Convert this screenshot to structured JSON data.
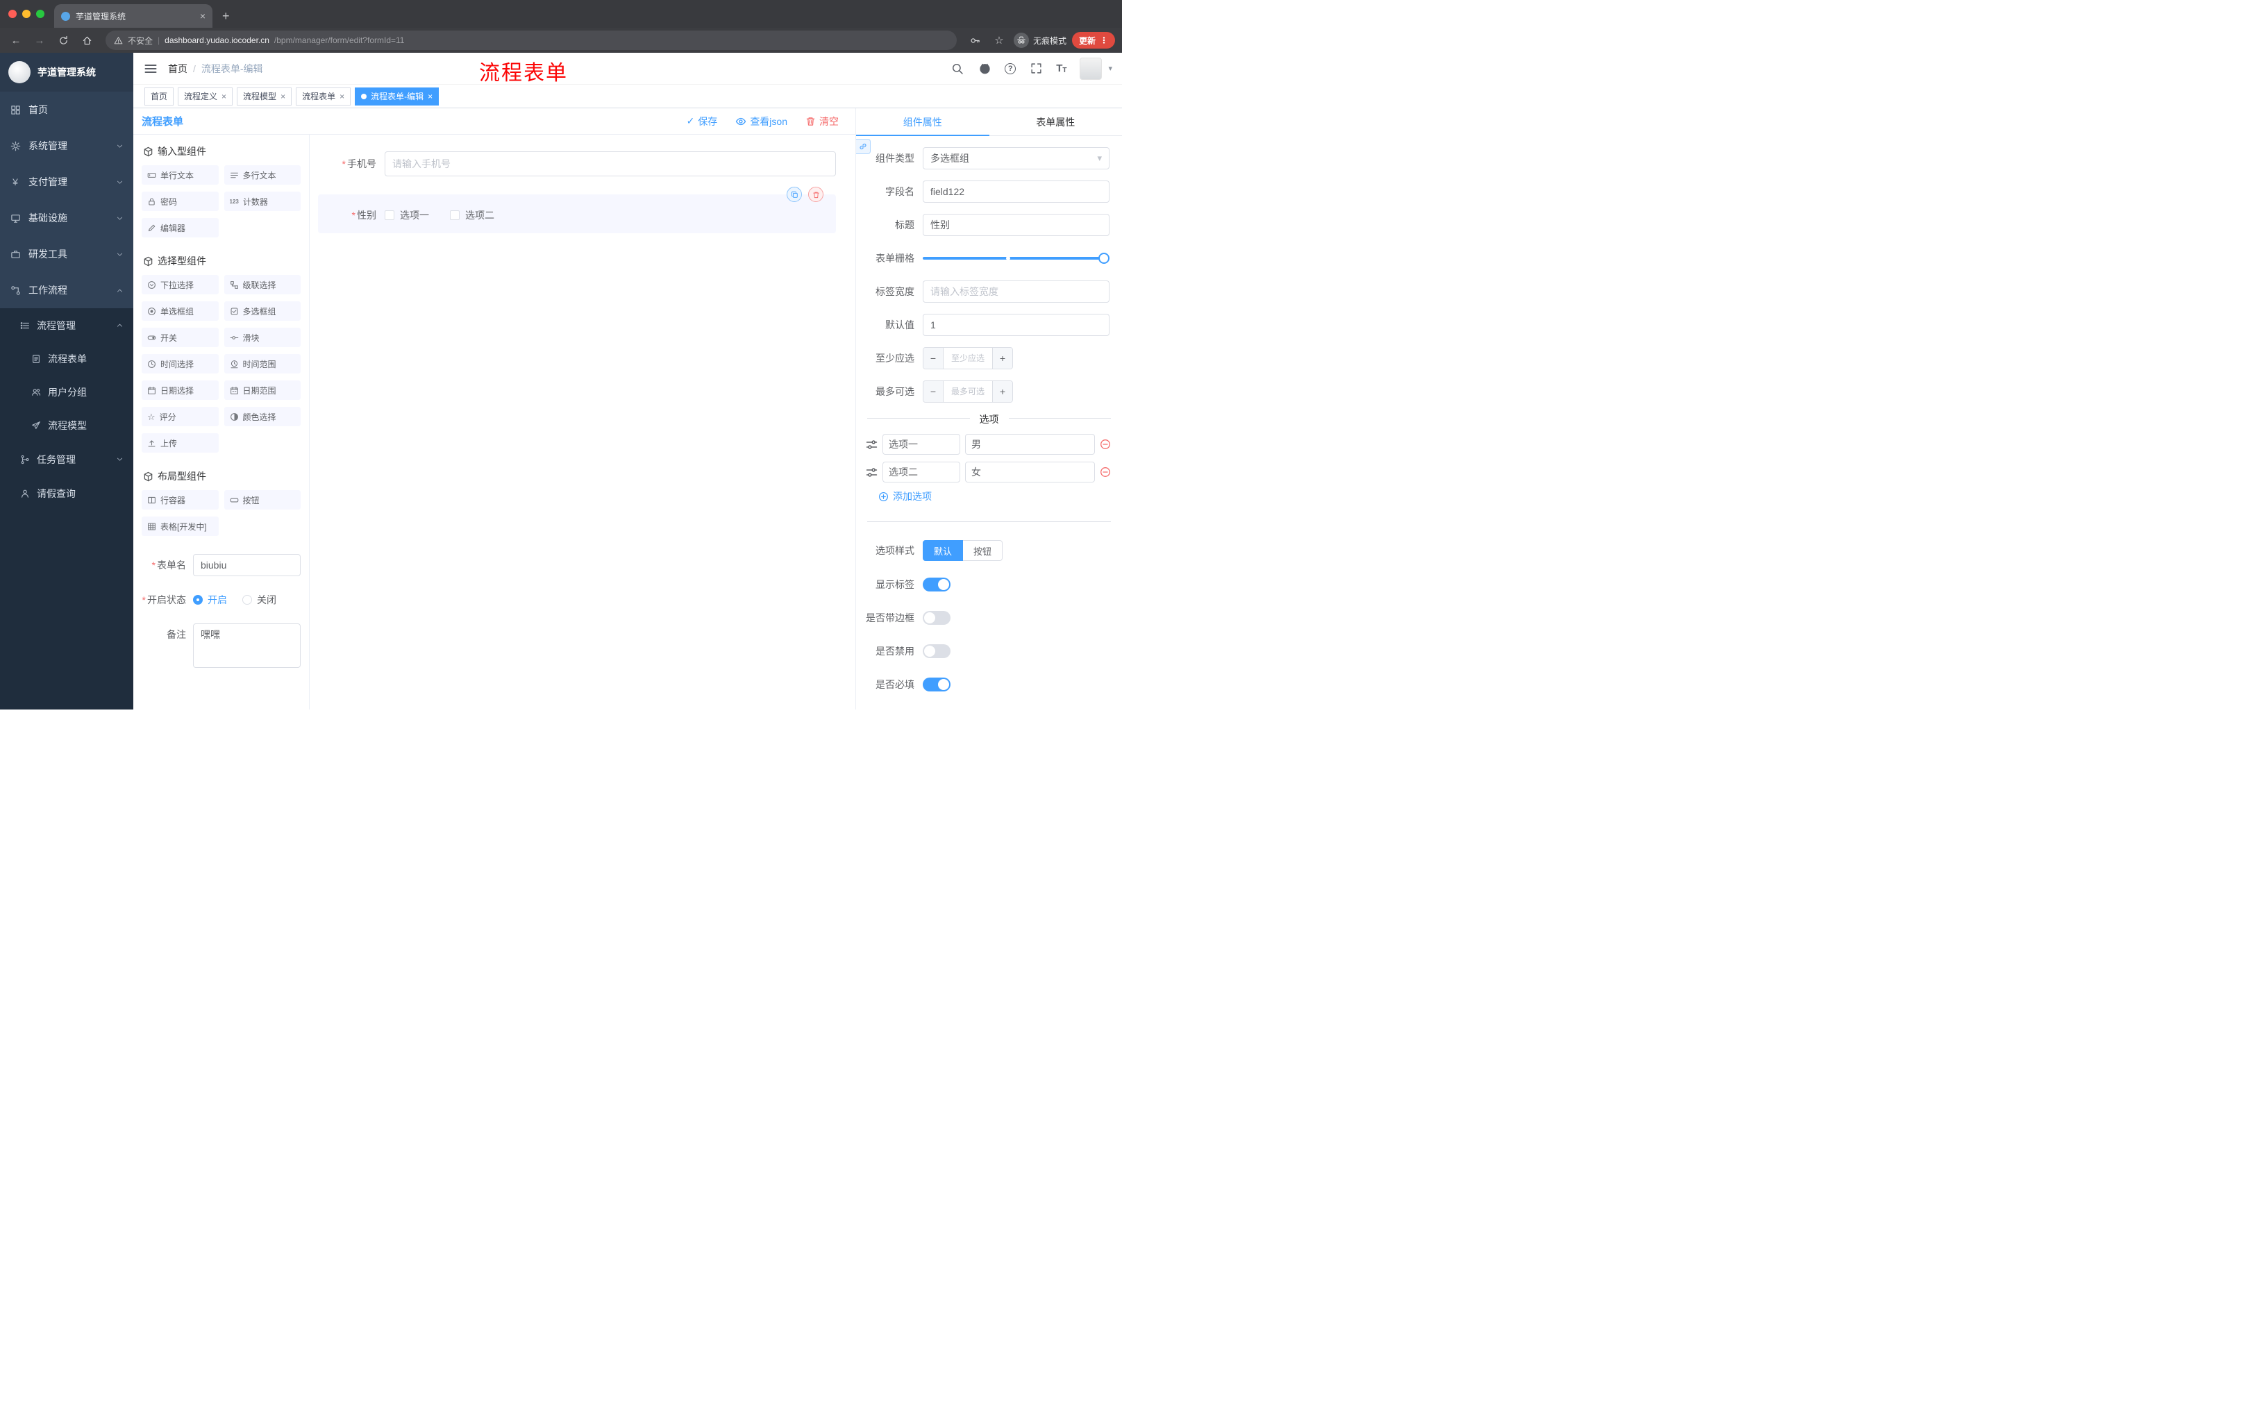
{
  "icons": {
    "close": "×",
    "new_tab": "+",
    "back": "←",
    "forward": "→",
    "more": "⋮",
    "star": "☆",
    "check": "✓",
    "caret_down": "▾",
    "minus": "−",
    "plus": "+",
    "yen": "¥",
    "help": "?",
    "asterisk": "*",
    "counter": "123",
    "slash": "/",
    "pipe": "|",
    "font_big": "T",
    "font_small": "T"
  },
  "browser": {
    "tab": {
      "title": "芋道管理系统"
    },
    "address": {
      "security": "不安全",
      "domain": "dashboard.yudao.iocoder.cn",
      "path": "/bpm/manager/form/edit?formId=11"
    },
    "incognito": "无痕模式",
    "update": "更新"
  },
  "sidebar": {
    "app_title": "芋道管理系统",
    "items": [
      {
        "label": "首页"
      },
      {
        "label": "系统管理"
      },
      {
        "label": "支付管理"
      },
      {
        "label": "基础设施"
      },
      {
        "label": "研发工具"
      },
      {
        "label": "工作流程"
      }
    ],
    "submenu": {
      "process_mgmt": {
        "label": "流程管理",
        "children": [
          {
            "label": "流程表单"
          },
          {
            "label": "用户分组"
          },
          {
            "label": "流程模型"
          }
        ]
      },
      "task_mgmt": {
        "label": "任务管理"
      },
      "leave_query": {
        "label": "请假查询"
      }
    }
  },
  "header": {
    "breadcrumb": {
      "root": "首页",
      "current": "流程表单-编辑"
    },
    "annotation": "流程表单"
  },
  "tags": [
    {
      "label": "首页"
    },
    {
      "label": "流程定义"
    },
    {
      "label": "流程模型"
    },
    {
      "label": "流程表单"
    },
    {
      "label": "流程表单-编辑"
    }
  ],
  "designer": {
    "title": "流程表单",
    "actions": {
      "save": "保存",
      "view_json": "查看json",
      "clear": "清空"
    },
    "groups": [
      {
        "title": "输入型组件",
        "items": [
          "单行文本",
          "多行文本",
          "密码",
          "计数器",
          "编辑器"
        ]
      },
      {
        "title": "选择型组件",
        "items": [
          "下拉选择",
          "级联选择",
          "单选框组",
          "多选框组",
          "开关",
          "滑块",
          "时间选择",
          "时间范围",
          "日期选择",
          "日期范围",
          "评分",
          "颜色选择",
          "上传"
        ]
      },
      {
        "title": "布局型组件",
        "items": [
          "行容器",
          "按钮",
          "表格[开发中]"
        ]
      }
    ],
    "meta": {
      "form_name": {
        "label": "表单名",
        "value": "biubiu"
      },
      "status": {
        "label": "开启状态",
        "on": "开启",
        "off": "关闭"
      },
      "remark": {
        "label": "备注",
        "value": "嘿嘿"
      }
    },
    "canvas": {
      "phone": {
        "label": "手机号",
        "placeholder": "请输入手机号"
      },
      "gender": {
        "label": "性别",
        "options": [
          "选项一",
          "选项二"
        ]
      }
    }
  },
  "props": {
    "tabs": {
      "component": "组件属性",
      "form": "表单属性"
    },
    "component_type": {
      "label": "组件类型",
      "value": "多选框组"
    },
    "field_name": {
      "label": "字段名",
      "value": "field122"
    },
    "title": {
      "label": "标题",
      "value": "性别"
    },
    "grid": {
      "label": "表单栅格"
    },
    "label_width": {
      "label": "标签宽度",
      "placeholder": "请输入标签宽度"
    },
    "default": {
      "label": "默认值",
      "value": "1"
    },
    "min": {
      "label": "至少应选",
      "placeholder": "至少应选"
    },
    "max": {
      "label": "最多可选",
      "placeholder": "最多可选"
    },
    "options": {
      "divider": "选项",
      "rows": [
        {
          "name": "选项一",
          "value": "男"
        },
        {
          "name": "选项二",
          "value": "女"
        }
      ],
      "add": "添加选项"
    },
    "option_style": {
      "label": "选项样式",
      "default": "默认",
      "button": "按钮"
    },
    "switches": [
      {
        "label": "显示标签"
      },
      {
        "label": "是否带边框"
      },
      {
        "label": "是否禁用"
      },
      {
        "label": "是否必填"
      }
    ]
  }
}
